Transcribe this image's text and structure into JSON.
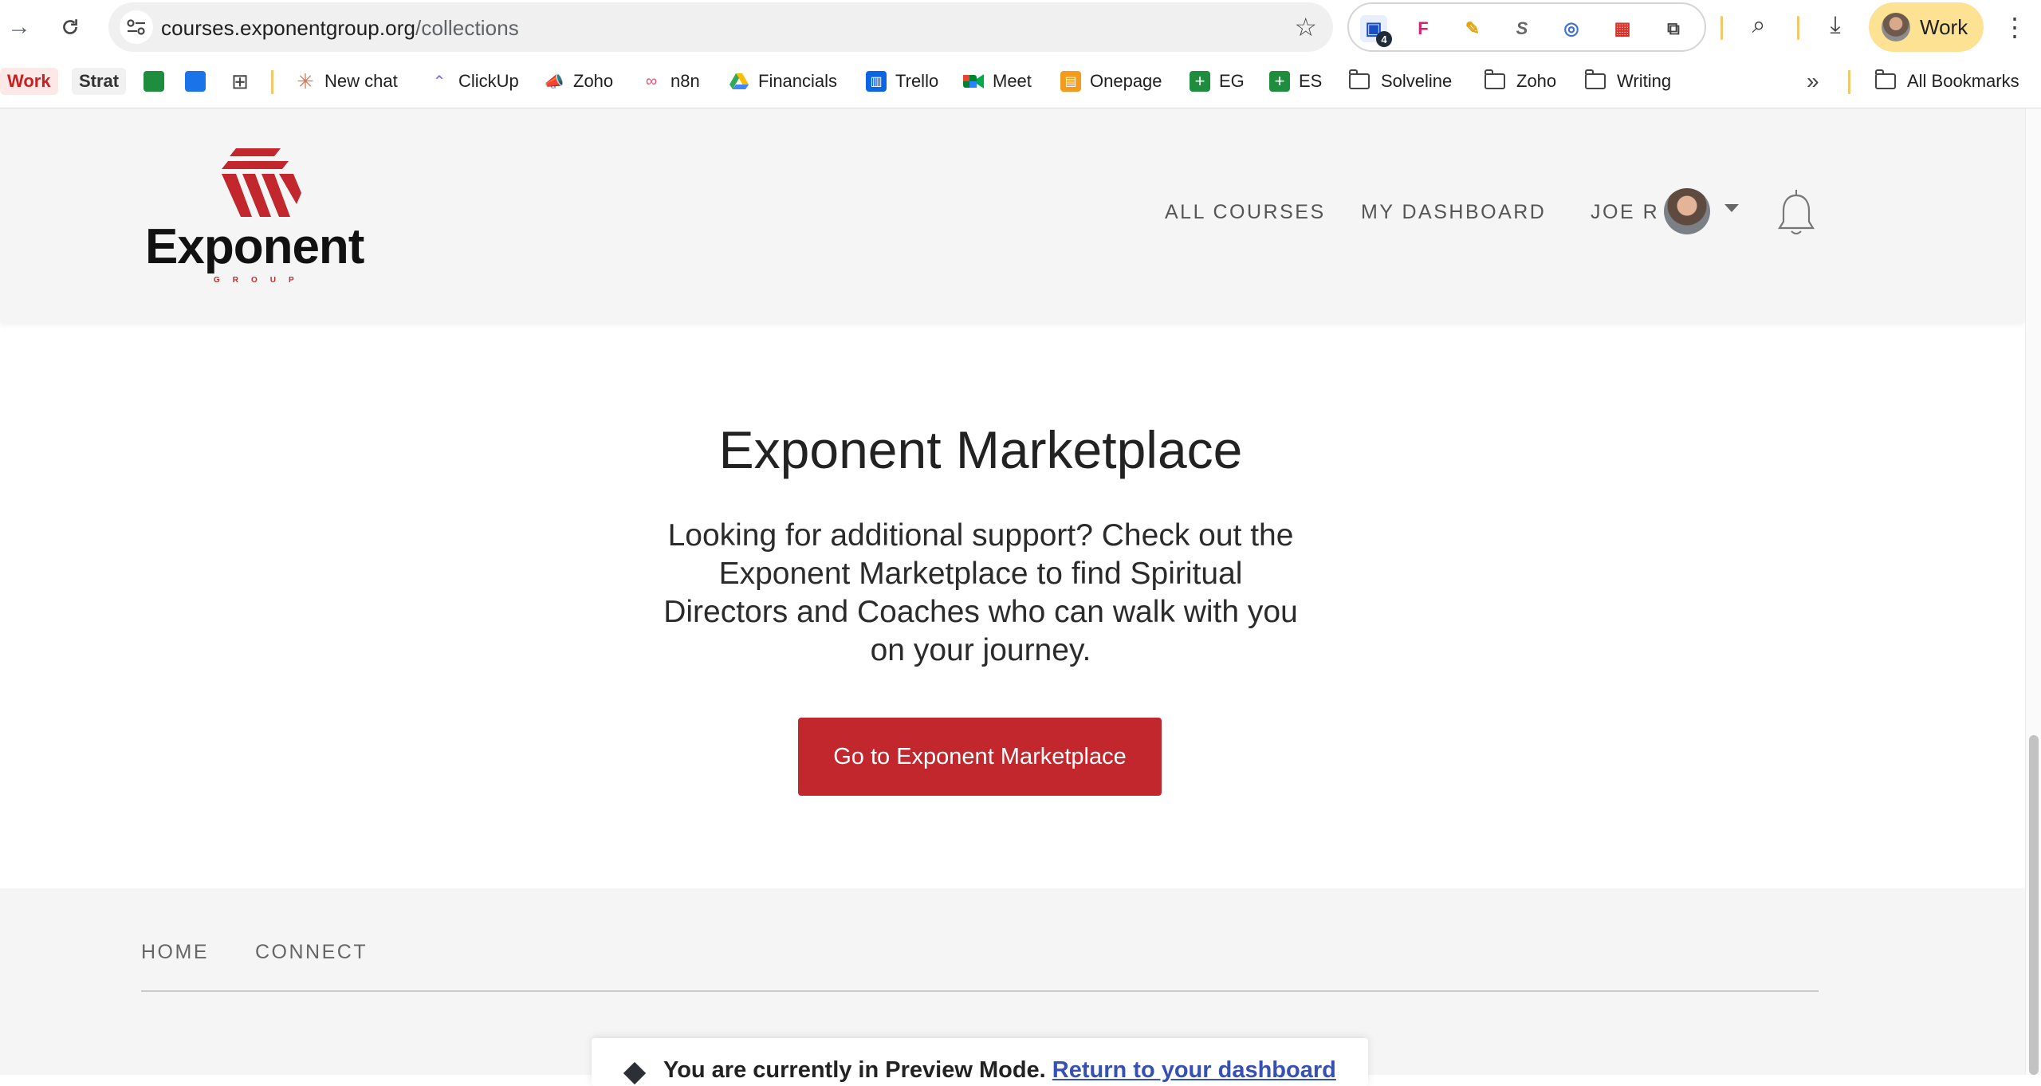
{
  "browser": {
    "url_host": "courses.exponentgroup.org",
    "url_path": "/collections",
    "extension_badge": "4",
    "profile_label": "Work"
  },
  "bookmarks": {
    "chips": [
      "Work",
      "Strat"
    ],
    "items": [
      "New chat",
      "ClickUp",
      "Zoho",
      "n8n",
      "Financials",
      "Trello",
      "Meet",
      "Onepage",
      "EG",
      "ES"
    ],
    "folders": [
      "Solveline",
      "Zoho",
      "Writing"
    ],
    "all_bookmarks": "All Bookmarks"
  },
  "site": {
    "logo_text": "Exponent",
    "logo_subtext": "GROUP",
    "nav": {
      "all_courses": "ALL COURSES",
      "my_dashboard": "MY DASHBOARD",
      "user": "JOE R"
    },
    "main": {
      "title": "Exponent Marketplace",
      "description": "Looking for additional support? Check out the Exponent Marketplace to find Spiritual Directors and Coaches who can walk with you on your journey.",
      "cta": "Go to Exponent Marketplace"
    },
    "footer": {
      "home": "HOME",
      "connect": "CONNECT"
    },
    "preview": {
      "text": "You are currently in Preview Mode.",
      "link": "Return to your dashboard"
    }
  },
  "colors": {
    "brand_red": "#c1272d",
    "profile_chip": "#fde293",
    "link_blue": "#3750b2"
  }
}
